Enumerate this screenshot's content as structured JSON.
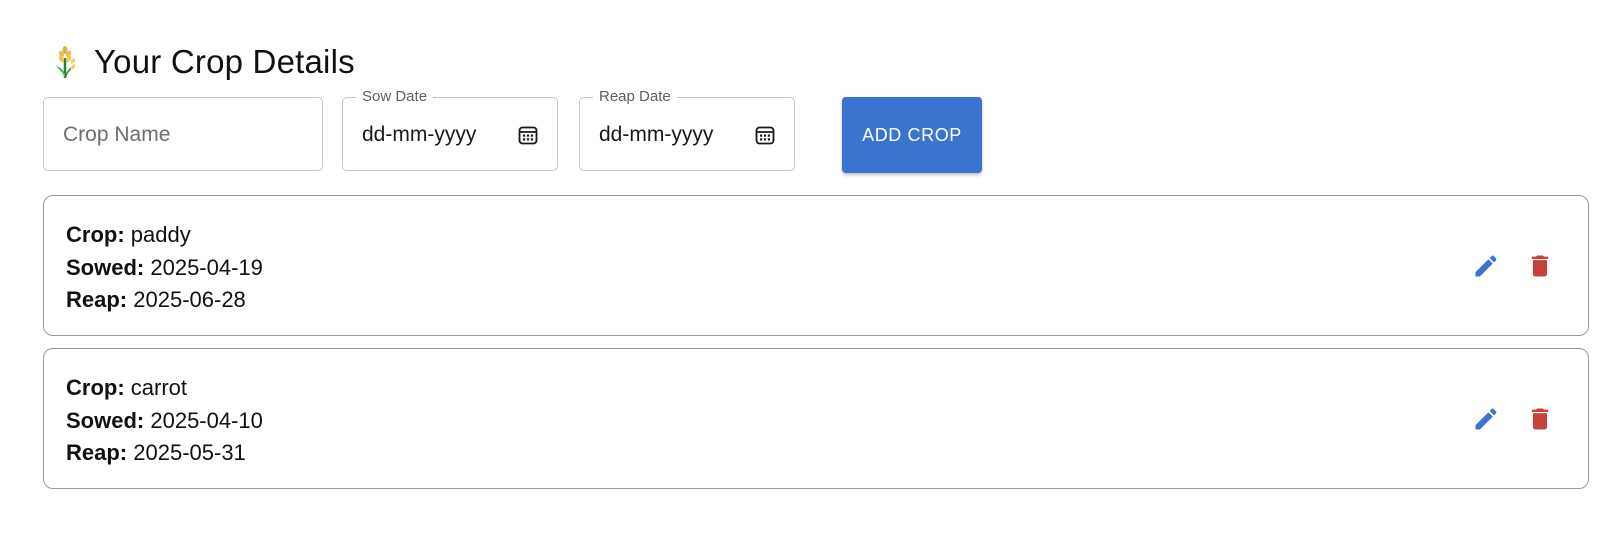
{
  "header": {
    "title": "Your Crop Details",
    "icon": "wheat-icon"
  },
  "form": {
    "crop_name": {
      "placeholder": "Crop Name",
      "value": ""
    },
    "sow_date": {
      "label": "Sow Date",
      "value": "dd-mm-yyyy",
      "icon": "calendar-icon"
    },
    "reap_date": {
      "label": "Reap Date",
      "value": "dd-mm-yyyy",
      "icon": "calendar-icon"
    },
    "add_button_label": "ADD CROP"
  },
  "labels": {
    "crop": "Crop:",
    "sowed": "Sowed:",
    "reap": "Reap:"
  },
  "crops": [
    {
      "name": "paddy",
      "sowed": "2025-04-19",
      "reap": "2025-06-28"
    },
    {
      "name": "carrot",
      "sowed": "2025-04-10",
      "reap": "2025-05-31"
    }
  ],
  "colors": {
    "accent": "#3a74d0",
    "edit": "#3a74d0",
    "delete": "#c8413a"
  }
}
